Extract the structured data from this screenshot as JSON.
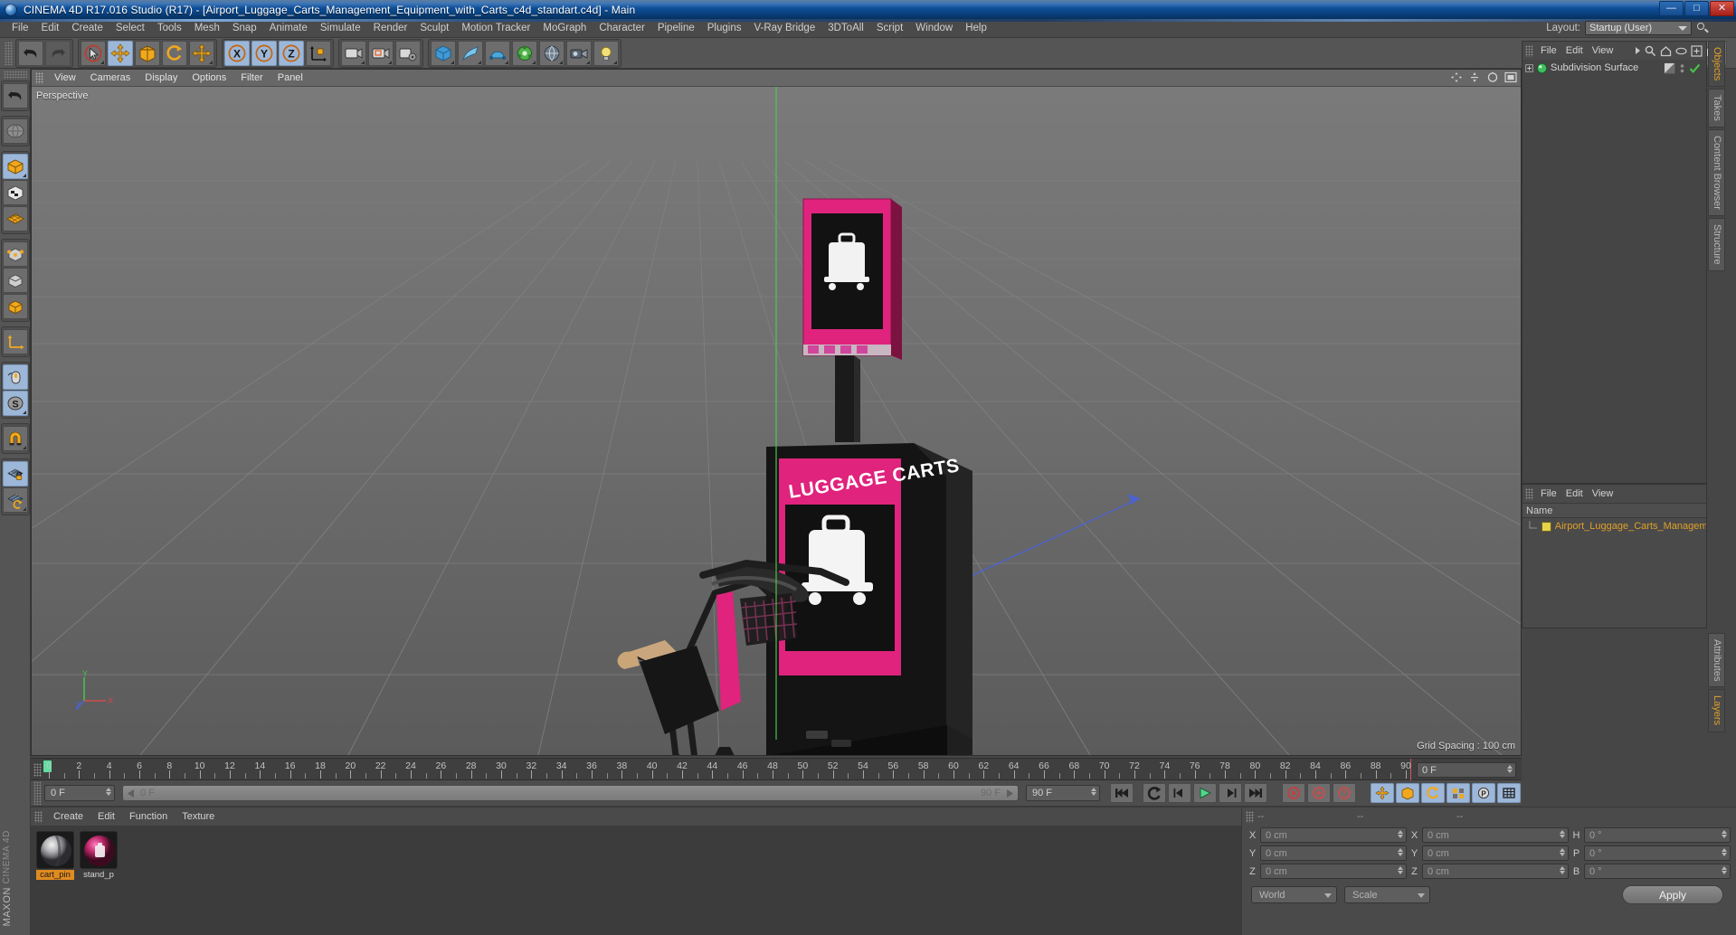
{
  "window": {
    "title": "CINEMA 4D R17.016 Studio (R17) - [Airport_Luggage_Carts_Management_Equipment_with_Carts_c4d_standart.c4d] - Main",
    "minimize": "—",
    "maximize": "□",
    "close": "✕"
  },
  "menubar": {
    "items": [
      "File",
      "Edit",
      "Create",
      "Select",
      "Tools",
      "Mesh",
      "Snap",
      "Animate",
      "Simulate",
      "Render",
      "Sculpt",
      "Motion Tracker",
      "MoGraph",
      "Character",
      "Pipeline",
      "Plugins",
      "V-Ray Bridge",
      "3DToAll",
      "Script",
      "Window",
      "Help"
    ],
    "layout_label": "Layout:",
    "layout_value": "Startup (User)",
    "search_icon": "magnifier-icon"
  },
  "toolbar": {
    "buttons": [
      {
        "name": "undo-button",
        "icon": "undo-arrow-icon",
        "state": "normal"
      },
      {
        "name": "redo-button",
        "icon": "redo-arrow-icon",
        "state": "dim"
      },
      {
        "name": "live-selection-button",
        "icon": "cursor-circle-icon",
        "state": "normal"
      },
      {
        "name": "move-button",
        "icon": "move-arrows-icon",
        "state": "selected"
      },
      {
        "name": "scale-button",
        "icon": "scale-box-icon",
        "state": "normal"
      },
      {
        "name": "rotate-button",
        "icon": "rotate-circle-icon",
        "state": "normal"
      },
      {
        "name": "move-alt-button",
        "icon": "move-arrows-icon",
        "state": "normal"
      },
      {
        "name": "x-axis-lock-button",
        "icon": "axis-x-icon",
        "state": "selected"
      },
      {
        "name": "y-axis-lock-button",
        "icon": "axis-y-icon",
        "state": "selected"
      },
      {
        "name": "z-axis-lock-button",
        "icon": "axis-z-icon",
        "state": "selected"
      },
      {
        "name": "world-object-coord-button",
        "icon": "world-axis-cube-icon",
        "state": "normal"
      },
      {
        "name": "render-view-button",
        "icon": "camera-render-icon",
        "state": "normal"
      },
      {
        "name": "render-region-button",
        "icon": "render-region-icon",
        "state": "normal"
      },
      {
        "name": "render-settings-button",
        "icon": "render-settings-icon",
        "state": "normal"
      },
      {
        "name": "cube-primitive-button",
        "icon": "cube-icon",
        "state": "normal"
      },
      {
        "name": "spline-pen-button",
        "icon": "pen-spline-icon",
        "state": "normal"
      },
      {
        "name": "generator-button",
        "icon": "nurbs-generator-icon",
        "state": "normal"
      },
      {
        "name": "deformer-button",
        "icon": "deformer-icon",
        "state": "normal"
      },
      {
        "name": "scene-object-button",
        "icon": "environment-icon",
        "state": "normal"
      },
      {
        "name": "camera-button",
        "icon": "camera-icon",
        "state": "normal"
      },
      {
        "name": "light-button",
        "icon": "light-bulb-icon",
        "state": "normal"
      }
    ],
    "render_indicator": "render-queue-icon"
  },
  "lefttoolbar": {
    "buttons": [
      {
        "name": "undo-tool-button",
        "icon": "undo-arrow-icon",
        "state": "normal"
      },
      {
        "name": "world-grid-button",
        "icon": "globe-grid-icon",
        "state": "normal"
      },
      {
        "name": "model-mode-button",
        "icon": "orange-cube-icon",
        "state": "selected"
      },
      {
        "name": "texture-mode-button",
        "icon": "checker-cube-icon",
        "state": "normal"
      },
      {
        "name": "workplane-button",
        "icon": "orange-grid-plane-icon",
        "state": "normal"
      },
      {
        "name": "points-mode-button",
        "icon": "cube-points-icon",
        "state": "normal"
      },
      {
        "name": "edges-mode-button",
        "icon": "cube-edges-icon",
        "state": "normal"
      },
      {
        "name": "polygons-mode-button",
        "icon": "cube-polygons-icon",
        "state": "normal"
      },
      {
        "name": "axis-mode-button",
        "icon": "axis-arrows-icon",
        "state": "normal"
      },
      {
        "name": "viewport-solo-button",
        "icon": "mouse-icon",
        "state": "selected"
      },
      {
        "name": "scale-lock-button",
        "icon": "s-circle-icon",
        "state": "selected"
      },
      {
        "name": "magnet-button",
        "icon": "magnet-icon",
        "state": "normal"
      },
      {
        "name": "workplane-lock-button",
        "icon": "grid-lock-icon",
        "state": "selected"
      },
      {
        "name": "workplane-reset-button",
        "icon": "grid-refresh-icon",
        "state": "normal"
      }
    ],
    "brand_top": "MAXON",
    "brand_bottom": "CINEMA 4D"
  },
  "viewport": {
    "menu": [
      "View",
      "Cameras",
      "Display",
      "Options",
      "Filter",
      "Panel"
    ],
    "label": "Perspective",
    "grid_spacing": "Grid Spacing : 100 cm",
    "axis_labels": {
      "x": "X",
      "y": "Y",
      "z": "Z"
    },
    "scene": {
      "sign_text": "LUGGAGE CARTS",
      "accent_color": "#e0237d",
      "body_color": "#151515"
    }
  },
  "timeline": {
    "start": 0,
    "end": 90,
    "step": 2,
    "labels": [
      "0",
      "2",
      "4",
      "6",
      "8",
      "10",
      "12",
      "14",
      "16",
      "18",
      "20",
      "22",
      "24",
      "26",
      "28",
      "30",
      "32",
      "34",
      "36",
      "38",
      "40",
      "42",
      "44",
      "46",
      "48",
      "50",
      "52",
      "54",
      "56",
      "58",
      "60",
      "62",
      "64",
      "66",
      "68",
      "70",
      "72",
      "74",
      "76",
      "78",
      "80",
      "82",
      "84",
      "86",
      "88",
      "90"
    ],
    "current_frame_field": "0 F"
  },
  "playbar": {
    "current_frame": "0 F",
    "range_start": "0 F",
    "range_end": "90 F",
    "end_frame_field": "90 F",
    "buttons": [
      {
        "name": "go-to-start-button",
        "icon": "skip-start-icon",
        "state": "normal"
      },
      {
        "name": "loop-button",
        "icon": "loop-arrow-icon",
        "state": "normal"
      },
      {
        "name": "step-back-button",
        "icon": "step-back-icon",
        "state": "normal"
      },
      {
        "name": "play-button",
        "icon": "play-triangle-icon",
        "state": "normal"
      },
      {
        "name": "step-forward-button",
        "icon": "step-forward-icon",
        "state": "normal"
      },
      {
        "name": "play-forward-button",
        "icon": "play-forward-icon",
        "state": "normal"
      },
      {
        "name": "go-to-end-button",
        "icon": "skip-end-icon",
        "state": "normal"
      },
      {
        "name": "record-active-button",
        "icon": "record-dot-icon",
        "state": "normal"
      },
      {
        "name": "autokey-button",
        "icon": "autokey-circle-icon",
        "state": "normal"
      },
      {
        "name": "keyframe-help-button",
        "icon": "question-circle-icon",
        "state": "normal"
      },
      {
        "name": "position-key-button",
        "icon": "position-key-icon",
        "state": "selected"
      },
      {
        "name": "scale-key-button",
        "icon": "scale-key-icon",
        "state": "selected"
      },
      {
        "name": "rotation-key-button",
        "icon": "rotation-key-icon",
        "state": "selected"
      },
      {
        "name": "param-key-button",
        "icon": "param-key-icon",
        "state": "selected"
      },
      {
        "name": "pla-key-button",
        "icon": "pla-key-icon",
        "state": "selected"
      },
      {
        "name": "dope-sheet-button",
        "icon": "dopesheet-icon",
        "state": "selected"
      }
    ]
  },
  "materials": {
    "menu": [
      "Create",
      "Edit",
      "Function",
      "Texture"
    ],
    "items": [
      {
        "name": "cart_pin",
        "selected": true,
        "color": "#b9b9bd"
      },
      {
        "name": "stand_p",
        "selected": false,
        "color": "#c22a6e"
      }
    ]
  },
  "object_manager": {
    "menu": [
      "File",
      "Edit",
      "View"
    ],
    "more_icon": "chevron-right-icon",
    "tools": [
      "search-icon",
      "home-icon",
      "eye-icon",
      "expand-icon"
    ],
    "rows": [
      {
        "name": "Subdivision Surface",
        "icon": "subdivision-surface-icon",
        "expandable": true
      }
    ]
  },
  "layer_manager": {
    "menu": [
      "File",
      "Edit",
      "View"
    ],
    "header": "Name",
    "rows": [
      {
        "name": "Airport_Luggage_Carts_Managem",
        "color": "#e8d24a"
      }
    ]
  },
  "vtabs": {
    "top": [
      {
        "label": "Objects",
        "active": true
      },
      {
        "label": "Takes",
        "active": false
      },
      {
        "label": "Content Browser",
        "active": false
      },
      {
        "label": "Structure",
        "active": false
      }
    ],
    "bottom": [
      {
        "label": "Attributes",
        "active": false
      },
      {
        "label": "Layers",
        "active": true
      }
    ]
  },
  "coordinates": {
    "headers": [
      "--",
      "--",
      "--"
    ],
    "position": {
      "x_label": "X",
      "x": "0 cm",
      "y_label": "Y",
      "y": "0 cm",
      "z_label": "Z",
      "z": "0 cm"
    },
    "size": {
      "x_label": "X",
      "x": "0 cm",
      "y_label": "Y",
      "y": "0 cm",
      "z_label": "Z",
      "z": "0 cm"
    },
    "rotation": {
      "h_label": "H",
      "h": "0 °",
      "p_label": "P",
      "p": "0 °",
      "b_label": "B",
      "b": "0 °"
    },
    "coord_system": "World",
    "mode": "Scale",
    "apply_label": "Apply"
  }
}
